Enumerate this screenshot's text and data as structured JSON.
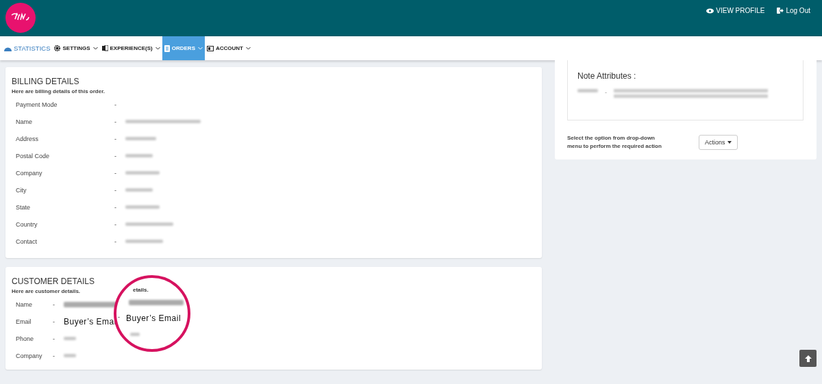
{
  "header": {
    "links": [
      {
        "label": "VIEW PROFILE"
      },
      {
        "label": "Log Out"
      }
    ]
  },
  "nav": [
    {
      "label": "STATISTICS",
      "kind": "link",
      "selected": false
    },
    {
      "label": "SETTINGS",
      "kind": "menu",
      "selected": false
    },
    {
      "label": "EXPERIENCE(S)",
      "kind": "menu",
      "selected": false
    },
    {
      "label": "ORDERS",
      "kind": "menu",
      "selected": true
    },
    {
      "label": "ACCOUNT",
      "kind": "menu",
      "selected": false
    }
  ],
  "billing": {
    "title": "BILLING DETAILS",
    "subtitle": "Here are billing details of this order.",
    "rows": [
      {
        "label": "Payment Mode",
        "separator": "-",
        "blurred": false
      },
      {
        "label": "Name",
        "separator": "-",
        "blurred": true
      },
      {
        "label": "Address",
        "separator": "-",
        "blurred": true
      },
      {
        "label": "Postal Code",
        "separator": "-",
        "blurred": true
      },
      {
        "label": "Company",
        "separator": "-",
        "blurred": true
      },
      {
        "label": "City",
        "separator": "-",
        "blurred": true
      },
      {
        "label": "State",
        "separator": "-",
        "blurred": true
      },
      {
        "label": "Country",
        "separator": "-",
        "blurred": true
      },
      {
        "label": "Contact",
        "separator": "-",
        "blurred": true
      }
    ]
  },
  "customer": {
    "title": "CUSTOMER DETAILS",
    "subtitle": "Here are customer details.",
    "rows": [
      {
        "label": "Name",
        "separator": "-",
        "blurred": true
      },
      {
        "label": "Email",
        "separator": "-",
        "value": "Buyer’s Emai"
      },
      {
        "label": "Phone",
        "separator": "-",
        "blurred": true
      },
      {
        "label": "Company",
        "separator": "-",
        "blurred": true
      }
    ]
  },
  "lens": {
    "subtitle_fragment": "etails.",
    "separator": "-",
    "value": "Buyer’s Email"
  },
  "note_attributes": {
    "title": "Note Attributes :",
    "separator": "-"
  },
  "actions": {
    "hint": "Select the option from drop-down menu to perform the required action",
    "button": "Actions"
  }
}
